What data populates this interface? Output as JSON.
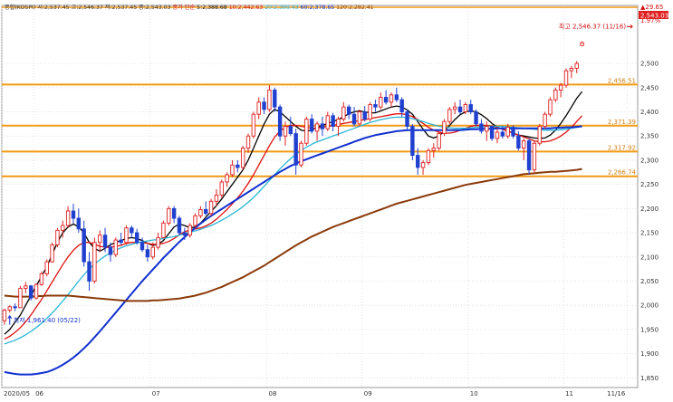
{
  "legend_line": "종합(KOSPI) 시:2,537.45 고:2,546.37 저:2,537.45 종:2,543.03    종가 단순 5:2,388.68 10:2,442.63 20:2,399.43 60:2,378.65 120:2,282.41",
  "legend_parts": [
    {
      "text": "종합(KOSPI) 시:2,537.45 고:2,546.37 저:2,537.45 종:2,543.03",
      "color": "#333333"
    },
    {
      "text": "종가 단순",
      "color": "#d01010"
    },
    {
      "text": "5:2,388.68",
      "color": "#111111"
    },
    {
      "text": "10:2,442.63",
      "color": "#d01010"
    },
    {
      "text": "20:2,399.43",
      "color": "#29b6d6"
    },
    {
      "text": "60:2,378.65",
      "color": "#1030d0"
    },
    {
      "text": "120:2,282.41",
      "color": "#8b3a0a"
    }
  ],
  "chart_data": {
    "type": "candlestick",
    "title": "",
    "ylim": [
      1830,
      2620
    ],
    "yticks": [
      1850,
      1900,
      1950,
      2000,
      2050,
      2100,
      2150,
      2200,
      2250,
      2300,
      2350,
      2400,
      2450,
      2500
    ],
    "ytick_labels": [
      "1,850",
      "1,900",
      "1,950",
      "2,000",
      "2,050",
      "2,100",
      "2,150",
      "2,200",
      "2,250",
      "2,300",
      "2,350",
      "2,400",
      "2,450",
      "2,500"
    ],
    "x_labels": [
      {
        "label": "2020/05",
        "index": 0
      },
      {
        "label": "06",
        "index": 6
      },
      {
        "label": "07",
        "index": 28
      },
      {
        "label": "08",
        "index": 50
      },
      {
        "label": "09",
        "index": 68
      },
      {
        "label": "10",
        "index": 88
      },
      {
        "label": "11",
        "index": 106
      },
      {
        "label": "11/16",
        "index": 118
      }
    ],
    "n_slots": 120,
    "candles": [
      [
        1968,
        1993,
        1960,
        1990
      ],
      [
        1990,
        2000,
        1985,
        1997
      ],
      [
        1997,
        2004,
        1988,
        1995
      ],
      [
        1995,
        2040,
        1995,
        2035
      ],
      [
        2035,
        2048,
        2025,
        2040
      ],
      [
        2040,
        2042,
        2010,
        2015
      ],
      [
        2015,
        2045,
        2012,
        2043
      ],
      [
        2043,
        2070,
        2040,
        2065
      ],
      [
        2065,
        2095,
        2060,
        2090
      ],
      [
        2090,
        2130,
        2088,
        2125
      ],
      [
        2125,
        2160,
        2120,
        2155
      ],
      [
        2155,
        2175,
        2140,
        2165
      ],
      [
        2165,
        2205,
        2160,
        2195
      ],
      [
        2195,
        2210,
        2170,
        2180
      ],
      [
        2180,
        2200,
        2150,
        2158
      ],
      [
        2158,
        2175,
        2080,
        2090
      ],
      [
        2090,
        2110,
        2030,
        2050
      ],
      [
        2050,
        2140,
        2045,
        2130
      ],
      [
        2130,
        2155,
        2110,
        2145
      ],
      [
        2145,
        2160,
        2110,
        2120
      ],
      [
        2120,
        2130,
        2090,
        2105
      ],
      [
        2105,
        2140,
        2100,
        2135
      ],
      [
        2135,
        2150,
        2125,
        2130
      ],
      [
        2130,
        2165,
        2125,
        2160
      ],
      [
        2160,
        2165,
        2140,
        2150
      ],
      [
        2150,
        2158,
        2125,
        2130
      ],
      [
        2130,
        2140,
        2110,
        2115
      ],
      [
        2115,
        2125,
        2090,
        2100
      ],
      [
        2100,
        2130,
        2095,
        2120
      ],
      [
        2120,
        2150,
        2115,
        2140
      ],
      [
        2140,
        2175,
        2138,
        2170
      ],
      [
        2170,
        2205,
        2165,
        2200
      ],
      [
        2200,
        2205,
        2170,
        2180
      ],
      [
        2180,
        2185,
        2145,
        2150
      ],
      [
        2150,
        2160,
        2135,
        2145
      ],
      [
        2145,
        2170,
        2140,
        2165
      ],
      [
        2165,
        2190,
        2160,
        2185
      ],
      [
        2185,
        2205,
        2180,
        2198
      ],
      [
        2198,
        2215,
        2185,
        2190
      ],
      [
        2190,
        2220,
        2185,
        2215
      ],
      [
        2215,
        2240,
        2205,
        2228
      ],
      [
        2228,
        2260,
        2222,
        2255
      ],
      [
        2255,
        2275,
        2245,
        2270
      ],
      [
        2270,
        2300,
        2265,
        2290
      ],
      [
        2290,
        2300,
        2275,
        2285
      ],
      [
        2285,
        2330,
        2280,
        2325
      ],
      [
        2325,
        2355,
        2315,
        2350
      ],
      [
        2350,
        2400,
        2345,
        2395
      ],
      [
        2395,
        2430,
        2385,
        2420
      ],
      [
        2420,
        2430,
        2395,
        2405
      ],
      [
        2405,
        2455,
        2400,
        2445
      ],
      [
        2445,
        2450,
        2400,
        2410
      ],
      [
        2410,
        2415,
        2340,
        2350
      ],
      [
        2350,
        2380,
        2330,
        2370
      ],
      [
        2370,
        2390,
        2350,
        2355
      ],
      [
        2355,
        2365,
        2270,
        2290
      ],
      [
        2290,
        2340,
        2285,
        2335
      ],
      [
        2335,
        2390,
        2330,
        2385
      ],
      [
        2385,
        2395,
        2355,
        2360
      ],
      [
        2360,
        2380,
        2340,
        2375
      ],
      [
        2375,
        2390,
        2350,
        2365
      ],
      [
        2365,
        2400,
        2360,
        2392
      ],
      [
        2392,
        2398,
        2360,
        2370
      ],
      [
        2370,
        2390,
        2350,
        2385
      ],
      [
        2385,
        2420,
        2380,
        2410
      ],
      [
        2410,
        2415,
        2385,
        2395
      ],
      [
        2395,
        2410,
        2370,
        2375
      ],
      [
        2375,
        2405,
        2370,
        2400
      ],
      [
        2400,
        2412,
        2380,
        2385
      ],
      [
        2385,
        2420,
        2380,
        2415
      ],
      [
        2415,
        2425,
        2400,
        2410
      ],
      [
        2410,
        2440,
        2405,
        2430
      ],
      [
        2430,
        2445,
        2415,
        2420
      ],
      [
        2420,
        2440,
        2410,
        2435
      ],
      [
        2435,
        2450,
        2420,
        2425
      ],
      [
        2425,
        2430,
        2390,
        2400
      ],
      [
        2400,
        2405,
        2360,
        2370
      ],
      [
        2370,
        2375,
        2300,
        2310
      ],
      [
        2310,
        2325,
        2270,
        2285
      ],
      [
        2285,
        2300,
        2270,
        2295
      ],
      [
        2295,
        2325,
        2290,
        2320
      ],
      [
        2320,
        2335,
        2305,
        2325
      ],
      [
        2325,
        2360,
        2320,
        2355
      ],
      [
        2355,
        2385,
        2350,
        2380
      ],
      [
        2380,
        2410,
        2375,
        2405
      ],
      [
        2405,
        2420,
        2395,
        2410
      ],
      [
        2410,
        2425,
        2395,
        2400
      ],
      [
        2400,
        2420,
        2395,
        2415
      ],
      [
        2415,
        2425,
        2395,
        2400
      ],
      [
        2400,
        2405,
        2370,
        2375
      ],
      [
        2375,
        2385,
        2355,
        2360
      ],
      [
        2360,
        2380,
        2340,
        2370
      ],
      [
        2370,
        2372,
        2340,
        2345
      ],
      [
        2345,
        2365,
        2335,
        2358
      ],
      [
        2358,
        2370,
        2345,
        2350
      ],
      [
        2350,
        2375,
        2345,
        2368
      ],
      [
        2368,
        2372,
        2345,
        2350
      ],
      [
        2350,
        2360,
        2320,
        2325
      ],
      [
        2325,
        2345,
        2300,
        2340
      ],
      [
        2340,
        2345,
        2270,
        2280
      ],
      [
        2280,
        2340,
        2275,
        2335
      ],
      [
        2335,
        2375,
        2330,
        2370
      ],
      [
        2370,
        2400,
        2365,
        2395
      ],
      [
        2395,
        2430,
        2390,
        2425
      ],
      [
        2425,
        2450,
        2420,
        2445
      ],
      [
        2445,
        2460,
        2430,
        2455
      ],
      [
        2455,
        2490,
        2450,
        2485
      ],
      [
        2485,
        2495,
        2470,
        2490
      ],
      [
        2490,
        2505,
        2480,
        2500
      ],
      [
        2537,
        2546,
        2537,
        2543
      ]
    ],
    "series": [
      {
        "name": "5",
        "color": "#000000",
        "values": [
          1940,
          1950,
          1965,
          1980,
          2000,
          2020,
          2040,
          2060,
          2080,
          2105,
          2130,
          2150,
          2162,
          2168,
          2162,
          2150,
          2130,
          2118,
          2112,
          2118,
          2125,
          2130,
          2134,
          2138,
          2140,
          2138,
          2134,
          2128,
          2124,
          2126,
          2134,
          2148,
          2162,
          2168,
          2165,
          2160,
          2162,
          2170,
          2182,
          2194,
          2206,
          2220,
          2235,
          2250,
          2265,
          2280,
          2300,
          2325,
          2350,
          2375,
          2395,
          2405,
          2400,
          2390,
          2380,
          2370,
          2362,
          2360,
          2362,
          2368,
          2372,
          2376,
          2380,
          2384,
          2390,
          2396,
          2400,
          2402,
          2400,
          2398,
          2398,
          2402,
          2406,
          2410,
          2412,
          2410,
          2404,
          2395,
          2380,
          2364,
          2350,
          2346,
          2350,
          2360,
          2372,
          2384,
          2394,
          2400,
          2402,
          2400,
          2394,
          2386,
          2376,
          2368,
          2364,
          2360,
          2356,
          2352,
          2350,
          2348,
          2346,
          2345,
          2346,
          2352,
          2362,
          2376,
          2392,
          2410,
          2428,
          2442
        ]
      },
      {
        "name": "10",
        "color": "#e01010",
        "values": [
          1930,
          1936,
          1944,
          1954,
          1966,
          1980,
          1996,
          2012,
          2030,
          2048,
          2066,
          2084,
          2100,
          2114,
          2124,
          2130,
          2130,
          2126,
          2122,
          2120,
          2120,
          2122,
          2124,
          2128,
          2130,
          2130,
          2130,
          2128,
          2126,
          2126,
          2128,
          2132,
          2138,
          2146,
          2152,
          2156,
          2158,
          2160,
          2164,
          2170,
          2178,
          2188,
          2198,
          2210,
          2222,
          2236,
          2252,
          2270,
          2290,
          2310,
          2330,
          2348,
          2360,
          2368,
          2372,
          2372,
          2370,
          2368,
          2366,
          2366,
          2368,
          2370,
          2372,
          2374,
          2376,
          2378,
          2380,
          2382,
          2384,
          2386,
          2388,
          2390,
          2392,
          2394,
          2396,
          2396,
          2394,
          2390,
          2384,
          2376,
          2368,
          2362,
          2358,
          2356,
          2356,
          2358,
          2362,
          2366,
          2370,
          2372,
          2372,
          2372,
          2370,
          2368,
          2364,
          2360,
          2356,
          2352,
          2348,
          2344,
          2340,
          2338,
          2338,
          2340,
          2344,
          2350,
          2358,
          2368,
          2380,
          2392
        ]
      },
      {
        "name": "20",
        "color": "#29b6d6",
        "values": [
          1920,
          1924,
          1928,
          1933,
          1939,
          1946,
          1954,
          1963,
          1973,
          1984,
          1996,
          2009,
          2022,
          2036,
          2050,
          2063,
          2075,
          2085,
          2094,
          2102,
          2108,
          2114,
          2119,
          2123,
          2126,
          2129,
          2131,
          2133,
          2135,
          2136,
          2138,
          2140,
          2142,
          2145,
          2148,
          2151,
          2154,
          2157,
          2161,
          2165,
          2170,
          2176,
          2182,
          2189,
          2196,
          2204,
          2213,
          2223,
          2234,
          2246,
          2258,
          2270,
          2282,
          2293,
          2303,
          2312,
          2320,
          2327,
          2333,
          2338,
          2342,
          2346,
          2350,
          2354,
          2358,
          2362,
          2366,
          2370,
          2374,
          2378,
          2381,
          2384,
          2386,
          2388,
          2389,
          2389,
          2388,
          2386,
          2383,
          2380,
          2376,
          2373,
          2370,
          2368,
          2367,
          2366,
          2366,
          2366,
          2367,
          2368,
          2369,
          2370,
          2370,
          2370,
          2370,
          2369,
          2368,
          2367,
          2366,
          2365,
          2364,
          2363,
          2362,
          2362,
          2362,
          2363,
          2364,
          2366,
          2368,
          2370
        ]
      },
      {
        "name": "60",
        "color": "#1030d0",
        "values": [
          1862,
          1860,
          1858,
          1857,
          1857,
          1857,
          1858,
          1860,
          1862,
          1866,
          1871,
          1877,
          1884,
          1892,
          1901,
          1911,
          1922,
          1934,
          1946,
          1959,
          1972,
          1985,
          1998,
          2011,
          2024,
          2037,
          2050,
          2062,
          2074,
          2086,
          2098,
          2109,
          2120,
          2131,
          2141,
          2151,
          2160,
          2169,
          2177,
          2185,
          2192,
          2199,
          2206,
          2213,
          2220,
          2227,
          2234,
          2241,
          2248,
          2255,
          2262,
          2269,
          2276,
          2282,
          2288,
          2293,
          2298,
          2302,
          2306,
          2310,
          2314,
          2318,
          2322,
          2326,
          2330,
          2334,
          2338,
          2342,
          2346,
          2349,
          2352,
          2354,
          2356,
          2358,
          2360,
          2361,
          2362,
          2362,
          2362,
          2362,
          2362,
          2362,
          2362,
          2362,
          2362,
          2362,
          2362,
          2363,
          2364,
          2364,
          2365,
          2365,
          2365,
          2366,
          2366,
          2366,
          2366,
          2366,
          2366,
          2366,
          2366,
          2366,
          2366,
          2366,
          2367,
          2367,
          2368,
          2368,
          2369,
          2370
        ]
      },
      {
        "name": "120",
        "color": "#8b3a0a",
        "values": [
          2020,
          2019,
          2018,
          2018,
          2018,
          2018,
          2019,
          2019,
          2020,
          2020,
          2020,
          2020,
          2020,
          2019,
          2018,
          2017,
          2016,
          2015,
          2014,
          2013,
          2012,
          2011,
          2010,
          2009,
          2009,
          2009,
          2009,
          2009,
          2010,
          2010,
          2011,
          2012,
          2013,
          2014,
          2016,
          2018,
          2020,
          2023,
          2026,
          2030,
          2034,
          2038,
          2043,
          2048,
          2053,
          2058,
          2064,
          2070,
          2076,
          2082,
          2089,
          2096,
          2103,
          2110,
          2117,
          2124,
          2130,
          2136,
          2142,
          2147,
          2152,
          2157,
          2162,
          2166,
          2170,
          2174,
          2178,
          2182,
          2186,
          2190,
          2194,
          2198,
          2202,
          2206,
          2210,
          2213,
          2216,
          2219,
          2222,
          2225,
          2228,
          2231,
          2234,
          2237,
          2240,
          2243,
          2246,
          2249,
          2251,
          2253,
          2255,
          2257,
          2259,
          2261,
          2263,
          2265,
          2267,
          2269,
          2271,
          2272,
          2273,
          2274,
          2275,
          2276,
          2276,
          2277,
          2278,
          2279,
          2280,
          2282
        ]
      }
    ],
    "horizontal_levels": [
      {
        "value": 2456.51,
        "label": "2,456.51"
      },
      {
        "value": 2371.39,
        "label": "2,371.39"
      },
      {
        "value": 2317.92,
        "label": "2,317.92"
      },
      {
        "value": 2266.74,
        "label": "2,266.74"
      }
    ],
    "annotations": [
      {
        "type": "high",
        "text": "최고 2,546.37 (11/16)",
        "index": 119,
        "value": 2546.37
      },
      {
        "type": "low",
        "text": "최저 1,961.40 (05/22)",
        "index": 1,
        "value": 1961.4
      }
    ],
    "last_price_label": "2,543.03",
    "last_change_label": "▲29.65",
    "last_change_pct_label": "1.97%"
  }
}
